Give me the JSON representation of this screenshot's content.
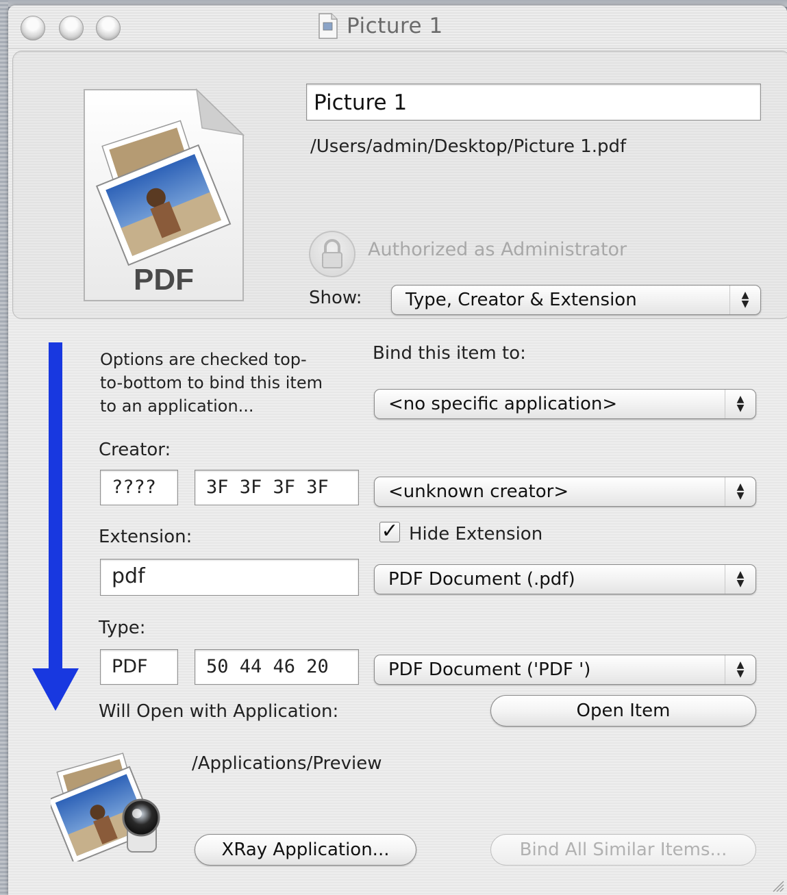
{
  "window": {
    "title": "Picture 1"
  },
  "info": {
    "name_value": "Picture 1",
    "path": "/Users/admin/Desktop/Picture 1.pdf",
    "icon_badge": "PDF",
    "auth_status": "Authorized as Administrator",
    "show_label": "Show:",
    "show_value": "Type, Creator & Extension"
  },
  "binding": {
    "description_lines": [
      "Options are checked top-",
      "to-bottom to bind this item",
      "to an application..."
    ],
    "bind_label": "Bind this item to:",
    "bind_value": "<no specific application>",
    "creator_label": "Creator:",
    "creator_code": "????",
    "creator_hex": "3F 3F 3F 3F",
    "creator_value": "<unknown creator>",
    "extension_label": "Extension:",
    "hide_extension_label": "Hide Extension",
    "hide_extension_checked": true,
    "extension_value": "pdf",
    "extension_popup": "PDF Document (.pdf)",
    "type_label": "Type:",
    "type_code": "PDF",
    "type_hex": "50 44 46 20",
    "type_popup": "PDF Document ('PDF ')",
    "will_open_label": "Will Open with Application:",
    "open_item_button": "Open Item",
    "app_path": "/Applications/Preview",
    "xray_button": "XRay Application...",
    "bind_all_button": "Bind All Similar Items..."
  },
  "colors": {
    "arrow": "#1838e0",
    "window_bg": "#e9e9e9",
    "disabled_text": "#b1b1b1"
  },
  "icons": [
    "close-light",
    "minimize-light",
    "zoom-light",
    "document-icon",
    "lock-icon",
    "pdf-document-icon",
    "preview-app-icon",
    "popup-arrows-icon",
    "checkmark-icon",
    "resize-grip-icon"
  ]
}
